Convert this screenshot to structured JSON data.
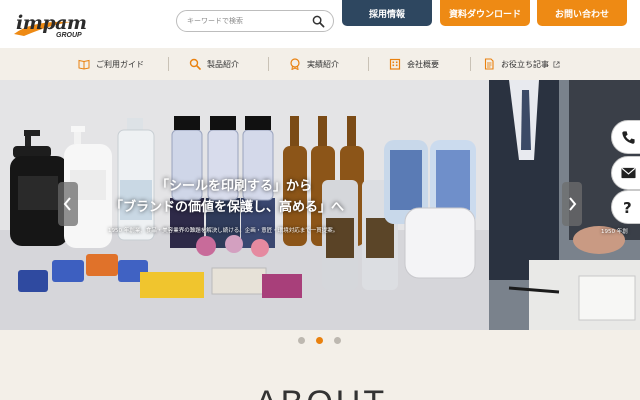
{
  "header": {
    "logo_text": "impam",
    "logo_sub": "GROUP",
    "search_placeholder": "キーワードで検索",
    "buttons": {
      "recruit": "採用情報",
      "download": "資料ダウンロード",
      "contact": "お問い合わせ"
    }
  },
  "nav": {
    "items": [
      {
        "label": "ご利用ガイド",
        "icon": "book-icon"
      },
      {
        "label": "製品紹介",
        "icon": "search-icon"
      },
      {
        "label": "実績紹介",
        "icon": "badge-icon"
      },
      {
        "label": "会社概要",
        "icon": "building-icon"
      },
      {
        "label": "お役立ち記事",
        "icon": "document-icon"
      }
    ]
  },
  "hero": {
    "headline_line1": "「シールを印刷する」から",
    "headline_line2": "「ブランドの価値を保護し、高める」へ",
    "sub": "1950 年創業、食品・美容業界の難題を解決し続ける。企画・意匠・環境対応まで一貫提案。",
    "next_sub": "1950 年創"
  },
  "slider": {
    "active_index": 1,
    "count": 3
  },
  "side_buttons": [
    "phone-icon",
    "mail-icon",
    "help-icon"
  ],
  "about": {
    "title": "ABOUT"
  },
  "colors": {
    "navy": "#2e4760",
    "orange": "#ee8a14",
    "beige": "#f3efe8"
  }
}
